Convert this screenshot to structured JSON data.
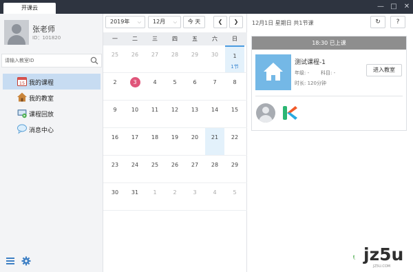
{
  "window": {
    "tab_title": "开课云",
    "controls": [
      "minimize",
      "maximize",
      "close"
    ]
  },
  "sidebar": {
    "user_name": "张老师",
    "user_id": "ID：101820",
    "search_placeholder": "请输入教室ID",
    "menu": [
      {
        "label": "我的课程",
        "icon": "calendar-icon",
        "active": true
      },
      {
        "label": "我的教室",
        "icon": "house-icon",
        "active": false
      },
      {
        "label": "课程回放",
        "icon": "replay-icon",
        "active": false
      },
      {
        "label": "消息中心",
        "icon": "chat-bubble-icon",
        "active": false
      }
    ],
    "bottom_icons": [
      "menu-icon",
      "gear-icon"
    ]
  },
  "calendar": {
    "year_select": "2019年",
    "month_select": "12月",
    "today_button": "今 天",
    "weekdays": [
      "一",
      "二",
      "三",
      "四",
      "五",
      "六",
      "日"
    ],
    "weeks": [
      [
        {
          "d": "25",
          "o": true
        },
        {
          "d": "26",
          "o": true
        },
        {
          "d": "27",
          "o": true
        },
        {
          "d": "28",
          "o": true
        },
        {
          "d": "29",
          "o": true
        },
        {
          "d": "30",
          "o": true
        },
        {
          "d": "1",
          "o": false,
          "sel": true,
          "count": "1节"
        }
      ],
      [
        {
          "d": "2"
        },
        {
          "d": "3",
          "today": true
        },
        {
          "d": "4"
        },
        {
          "d": "5"
        },
        {
          "d": "6"
        },
        {
          "d": "7"
        },
        {
          "d": "8"
        }
      ],
      [
        {
          "d": "9"
        },
        {
          "d": "10"
        },
        {
          "d": "11"
        },
        {
          "d": "12"
        },
        {
          "d": "13"
        },
        {
          "d": "14"
        },
        {
          "d": "15"
        }
      ],
      [
        {
          "d": "16"
        },
        {
          "d": "17"
        },
        {
          "d": "18"
        },
        {
          "d": "19"
        },
        {
          "d": "20"
        },
        {
          "d": "21",
          "sel2": true
        },
        {
          "d": "22"
        }
      ],
      [
        {
          "d": "23"
        },
        {
          "d": "24"
        },
        {
          "d": "25"
        },
        {
          "d": "26"
        },
        {
          "d": "27"
        },
        {
          "d": "28"
        },
        {
          "d": "29"
        }
      ],
      [
        {
          "d": "30"
        },
        {
          "d": "31"
        },
        {
          "d": "1",
          "o": true
        },
        {
          "d": "2",
          "o": true
        },
        {
          "d": "3",
          "o": true
        },
        {
          "d": "4",
          "o": true
        },
        {
          "d": "5",
          "o": true
        }
      ]
    ],
    "accent_color": "#4a9be0",
    "today_color": "#e0557a"
  },
  "detail": {
    "header": "12月1日 星期日 共1节课",
    "refresh_icon": "refresh-icon",
    "help_label": "?",
    "course": {
      "status": "18:30   已上课",
      "title": "测试课程-1",
      "grade": "年级: -",
      "subject": "科目: -",
      "duration": "时长: 120分钟",
      "enter_button": "进入教室"
    }
  },
  "watermark": {
    "text": "jz5u",
    "sub": "JZ5U.COM"
  }
}
